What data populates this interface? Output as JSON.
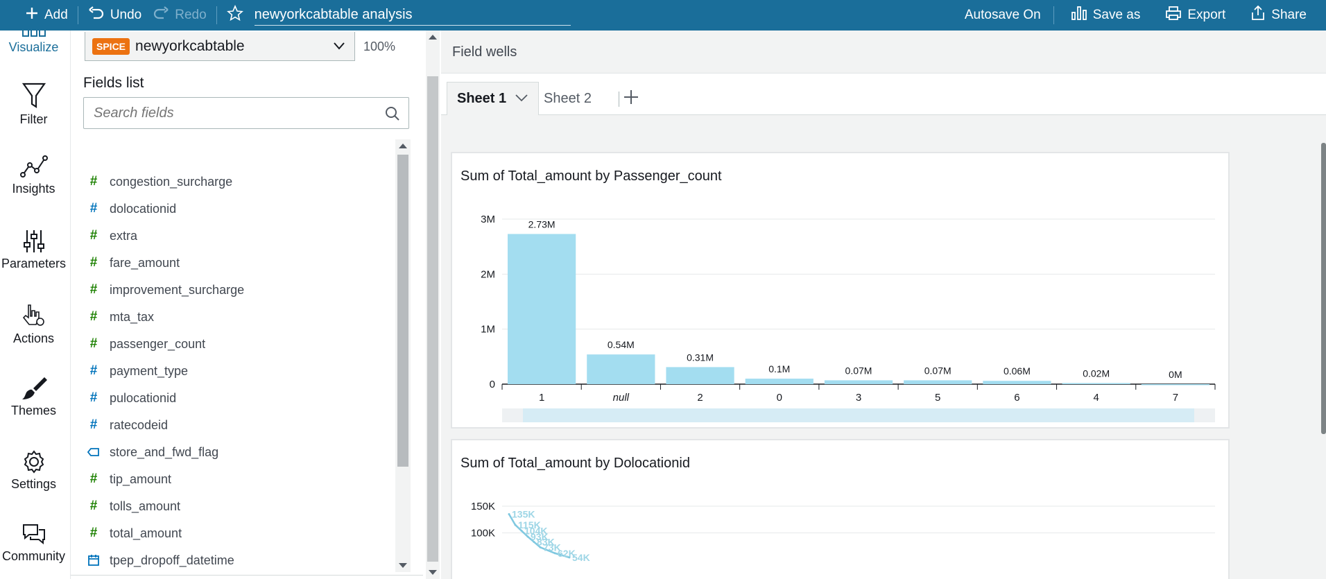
{
  "toolbar": {
    "add": "Add",
    "undo": "Undo",
    "redo": "Redo",
    "title": "newyorkcabtable analysis",
    "autosave": "Autosave On",
    "save_as": "Save as",
    "export": "Export",
    "share": "Share"
  },
  "nav": {
    "visualize": "Visualize",
    "filter": "Filter",
    "insights": "Insights",
    "parameters": "Parameters",
    "actions": "Actions",
    "themes": "Themes",
    "settings": "Settings",
    "community": "Community"
  },
  "fields_panel": {
    "spice_badge": "SPICE",
    "dataset": "newyorkcabtable",
    "zoom": "100%",
    "title": "Fields list",
    "search_placeholder": "Search fields",
    "fields": [
      {
        "name": "congestion_surcharge",
        "icon": "hash-measure-icon"
      },
      {
        "name": "dolocationid",
        "icon": "hash-dimension-icon"
      },
      {
        "name": "extra",
        "icon": "hash-measure-icon"
      },
      {
        "name": "fare_amount",
        "icon": "hash-measure-icon"
      },
      {
        "name": "improvement_surcharge",
        "icon": "hash-measure-icon"
      },
      {
        "name": "mta_tax",
        "icon": "hash-measure-icon"
      },
      {
        "name": "passenger_count",
        "icon": "hash-measure-icon"
      },
      {
        "name": "payment_type",
        "icon": "hash-dimension-icon"
      },
      {
        "name": "pulocationid",
        "icon": "hash-dimension-icon"
      },
      {
        "name": "ratecodeid",
        "icon": "hash-dimension-icon"
      },
      {
        "name": "store_and_fwd_flag",
        "icon": "string-tag-icon"
      },
      {
        "name": "tip_amount",
        "icon": "hash-measure-icon"
      },
      {
        "name": "tolls_amount",
        "icon": "hash-measure-icon"
      },
      {
        "name": "total_amount",
        "icon": "hash-measure-icon"
      },
      {
        "name": "tpep_dropoff_datetime",
        "icon": "calendar-icon"
      }
    ]
  },
  "main": {
    "field_wells": "Field wells",
    "tabs": [
      {
        "label": "Sheet 1",
        "active": true
      },
      {
        "label": "Sheet 2",
        "active": false
      }
    ]
  },
  "colors": {
    "topbar": "#1a6e9a",
    "bar": "#a3ddf0",
    "measure_icon": "#1d8102",
    "dimension_icon": "#0073bb",
    "spice": "#ec7211"
  },
  "chart_data": [
    {
      "type": "bar",
      "title": "Sum of Total_amount by Passenger_count",
      "xlabel": "",
      "ylabel": "",
      "categories": [
        "1",
        "null",
        "2",
        "0",
        "3",
        "5",
        "6",
        "4",
        "7"
      ],
      "values": [
        2730000,
        540000,
        310000,
        100000,
        70000,
        70000,
        60000,
        20000,
        0
      ],
      "data_labels": [
        "2.73M",
        "0.54M",
        "0.31M",
        "0.1M",
        "0.07M",
        "0.07M",
        "0.06M",
        "0.02M",
        "0M"
      ],
      "yticks": [
        0,
        1000000,
        2000000,
        3000000
      ],
      "ytick_labels": [
        "0",
        "1M",
        "2M",
        "3M"
      ],
      "ylim": [
        0,
        3000000
      ],
      "grid": true
    },
    {
      "type": "line",
      "title": "Sum of Total_amount by Dolocationid",
      "xlabel": "",
      "ylabel": "",
      "values": [
        135000,
        115000,
        104000,
        93000,
        83000,
        73000,
        62000,
        54000
      ],
      "data_labels": [
        "135K",
        "115K",
        "104K",
        "93K",
        "83K",
        "73K",
        "62K",
        "54K"
      ],
      "yticks": [
        100000,
        150000
      ],
      "ytick_labels": [
        "100K",
        "150K"
      ],
      "ylim": [
        50000,
        150000
      ],
      "grid": true
    }
  ]
}
